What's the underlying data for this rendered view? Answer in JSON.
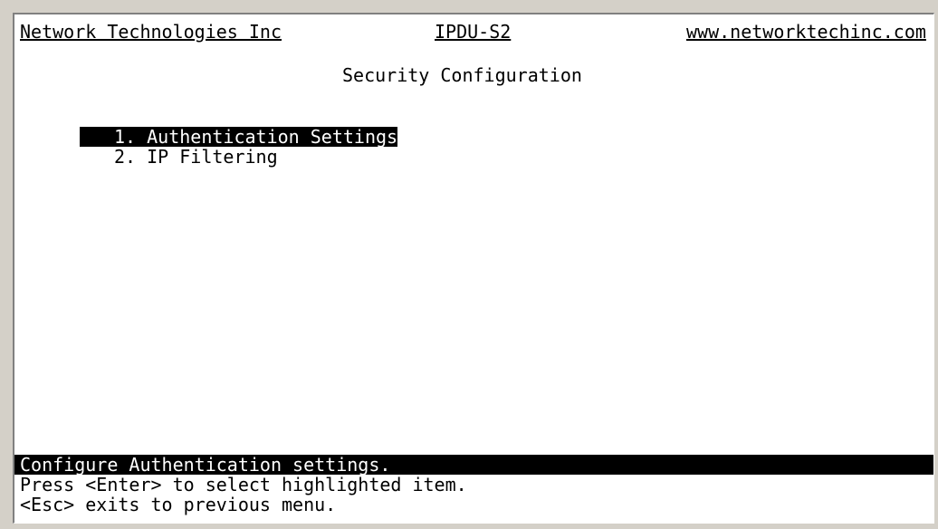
{
  "header": {
    "company": "Network Technologies Inc",
    "product": "IPDU-S2",
    "website": "www.networktechinc.com"
  },
  "screen": {
    "title": "Security Configuration"
  },
  "menu": {
    "items": [
      {
        "label": "1. Authentication Settings",
        "selected": true
      },
      {
        "label": "2. IP Filtering",
        "selected": false
      }
    ]
  },
  "footer": {
    "status": "Configure Authentication settings.",
    "hint_enter": "Press <Enter> to select highlighted item.",
    "hint_esc": "<Esc> exits to previous menu."
  }
}
